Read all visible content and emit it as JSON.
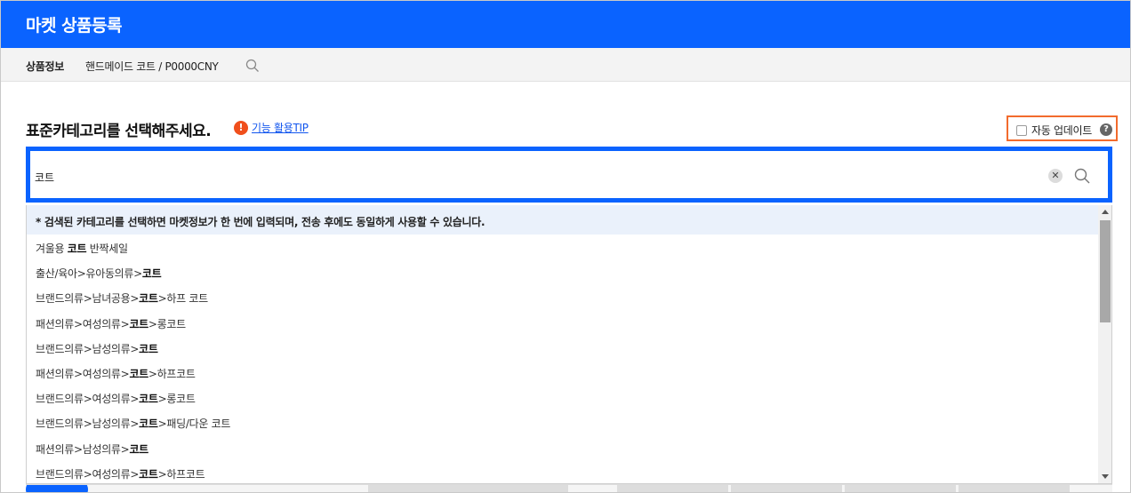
{
  "app": {
    "title": "마켓 상품등록"
  },
  "product": {
    "label": "상품정보",
    "value": "핸드메이드 코트 / P0000CNY"
  },
  "category": {
    "heading": "표준카테고리를 선택해주세요.",
    "tip_link": "기능 활용TIP",
    "auto_update_label": "자동 업데이트",
    "auto_update_checked": false
  },
  "search": {
    "query": "코트",
    "placeholder": ""
  },
  "results": {
    "notice": "* 검색된 카테고리를 선택하면 마켓정보가 한 번에 입력되며, 전송 후에도 동일하게 사용할 수 있습니다.",
    "items": [
      {
        "pre": "겨울용 ",
        "match": "코트",
        "post": " 반짝세일"
      },
      {
        "pre": "출산/육아>유아동의류>",
        "match": "코트",
        "post": ""
      },
      {
        "pre": "브랜드의류>남녀공용>",
        "match": "코트",
        "post": ">하프 코트"
      },
      {
        "pre": "패션의류>여성의류>",
        "match": "코트",
        "post": ">롱코트"
      },
      {
        "pre": "브랜드의류>남성의류>",
        "match": "코트",
        "post": ""
      },
      {
        "pre": "패션의류>여성의류>",
        "match": "코트",
        "post": ">하프코트"
      },
      {
        "pre": "브랜드의류>여성의류>",
        "match": "코트",
        "post": ">롱코트"
      },
      {
        "pre": "브랜드의류>남성의류>",
        "match": "코트",
        "post": ">패딩/다운 코트"
      },
      {
        "pre": "패션의류>남성의류>",
        "match": "코트",
        "post": ""
      },
      {
        "pre": "브랜드의류>여성의류>",
        "match": "코트",
        "post": ">하프코트"
      }
    ]
  },
  "colors": {
    "brand": "#0a63ff",
    "highlight": "#f26b2d",
    "tip": "#f04f1c"
  },
  "icons": {
    "search": "search-icon",
    "clear": "clear-icon",
    "help": "help-icon",
    "tip": "alert-icon"
  }
}
